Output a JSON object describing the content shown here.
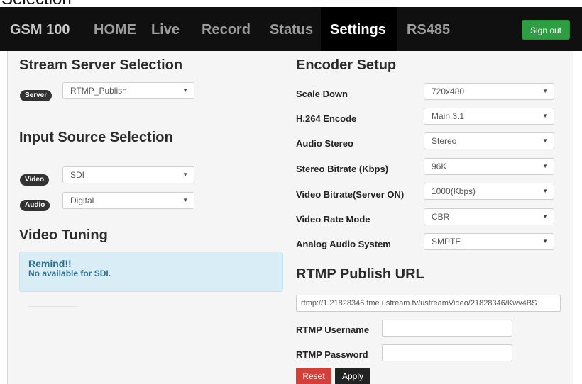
{
  "top_cut_text": "Selection",
  "nav": {
    "brand": "GSM 100",
    "items": [
      "HOME",
      "Live",
      "Record",
      "Status",
      "Settings",
      "RS485"
    ],
    "active": "Settings",
    "signout": "Sign out"
  },
  "left": {
    "stream_title": "Stream Server Selection",
    "server_badge": "Server",
    "server_value": "RTMP_Publish",
    "input_title": "Input Source Selection",
    "video_badge": "Video",
    "video_value": "SDI",
    "audio_badge": "Audio",
    "audio_value": "Digital",
    "tuning_title": "Video Tuning",
    "remind_title": "Remind!!",
    "remind_text": "No available for SDI."
  },
  "encoder": {
    "title": "Encoder Setup",
    "rows": [
      {
        "label": "Scale Down",
        "value": "720x480"
      },
      {
        "label": "H.264 Encode",
        "value": "Main 3.1"
      },
      {
        "label": "Audio Stereo",
        "value": "Stereo"
      },
      {
        "label": "Stereo Bitrate (Kbps)",
        "value": "96K"
      },
      {
        "label": "Video Bitrate(Server ON)",
        "value": "1000(Kbps)"
      },
      {
        "label": "Video Rate Mode",
        "value": "CBR"
      },
      {
        "label": "Analog Audio System",
        "value": "SMPTE"
      }
    ]
  },
  "rtmp": {
    "title": "RTMP Publish URL",
    "url": "rtmp://1.21828346.fme.ustream.tv/ustreamVideo/21828346/Kwv4BS",
    "username_label": "RTMP Username",
    "username_value": "",
    "password_label": "RTMP Password",
    "password_value": "",
    "reset": "Reset",
    "apply": "Apply"
  },
  "colors": {
    "navbar": "#101010",
    "signout": "#2e9e42",
    "reset": "#d43f3a",
    "alert_bg": "#d9edf7"
  }
}
